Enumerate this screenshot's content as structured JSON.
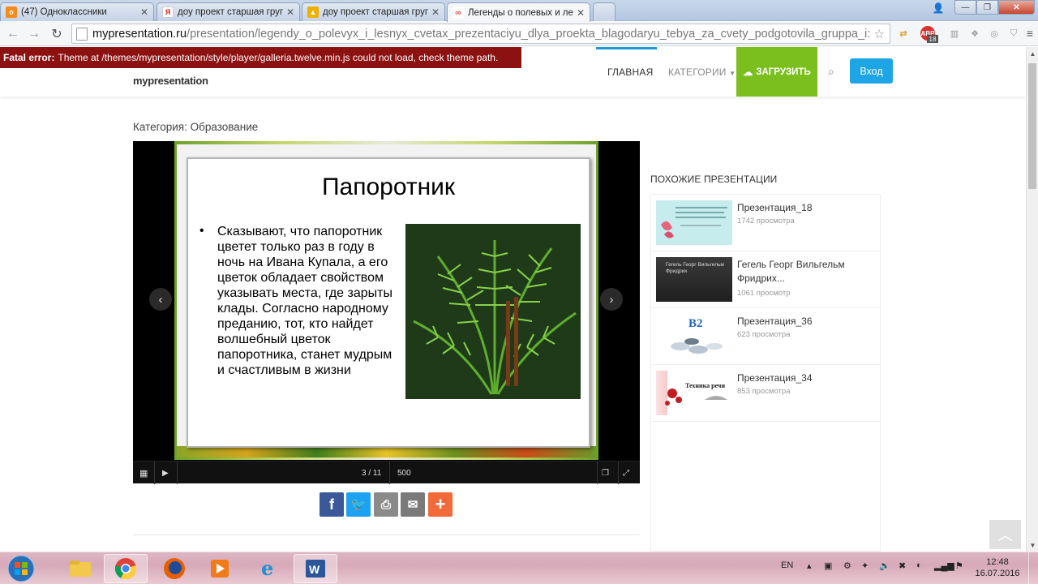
{
  "browser": {
    "tabs": [
      {
        "label": "(47) Одноклассники",
        "favicon_color": "#f28a1c"
      },
      {
        "label": "доу проект старшая груп",
        "favicon_color": "#d9261c"
      },
      {
        "label": "доу проект старшая груп",
        "favicon_color": "#f0b000"
      },
      {
        "label": "Легенды о полевых и лес",
        "favicon_color": "#e24f52"
      }
    ],
    "url_host": "mypresentation.ru",
    "url_path": "/presentation/legendy_o_polevyx_i_lesnyx_cvetax_prezentaciyu_dlya_proekta_blagodaryu_tebya_za_cvety_podgotovila_gruppa_i:",
    "abp_badge": "18"
  },
  "error": {
    "prefix": "Fatal error:",
    "message": "Theme at /themes/mypresentation/style/player/galleria.twelve.min.js could not load, check theme path."
  },
  "site": {
    "logo": "mypresentation",
    "menu": {
      "home": "ГЛАВНАЯ",
      "categories": "КАТЕГОРИИ",
      "upload": "ЗАГРУЗИТЬ",
      "login": "Вход"
    },
    "accent": "#1ea5e6",
    "upload_color": "#7bbf1f"
  },
  "main": {
    "category": "Категория: Образование",
    "slide": {
      "title": "Папоротник",
      "bullet": "•",
      "text": "Сказывают, что папоротник цветет только раз в году в ночь на Ивана Купала, а его цветок обладает свойством указывать места, где зарыты клады. Согласно народному преданию, тот, кто найдет волшебный цветок папоротника, станет мудрым и счастливым в жизни"
    },
    "player": {
      "counter": "3 / 11",
      "size": "500"
    },
    "share": [
      "facebook-icon",
      "twitter-icon",
      "print-icon",
      "email-icon",
      "plus-icon"
    ]
  },
  "sidebar": {
    "title": "ПОХОЖИЕ ПРЕЗЕНТАЦИИ",
    "items": [
      {
        "name": "Презентация_18",
        "views": "1742 просмотра"
      },
      {
        "name": "Гегель Георг Вильгельм Фридрих...",
        "views": "1061 просмотр",
        "thumb_text": "Гегель Георг Вильгельм Фридрих"
      },
      {
        "name": "Презентация_36",
        "views": "623 просмотра",
        "thumb_text": "B2"
      },
      {
        "name": "Презентация_34",
        "views": "853 просмотра",
        "thumb_text": "Техника речи"
      }
    ]
  },
  "taskbar": {
    "lang": "EN",
    "time": "12:48",
    "date": "16.07.2016"
  }
}
